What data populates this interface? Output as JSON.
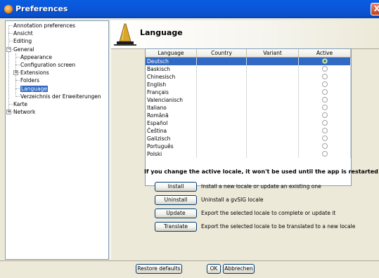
{
  "window": {
    "title": "Preferences",
    "close_glyph": "X"
  },
  "tree": {
    "items": [
      {
        "label": "Annotation preferences",
        "level": 0,
        "expander": ""
      },
      {
        "label": "Ansicht",
        "level": 0,
        "expander": ""
      },
      {
        "label": "Editing",
        "level": 0,
        "expander": ""
      },
      {
        "label": "General",
        "level": 0,
        "expander": "−"
      },
      {
        "label": "Appearance",
        "level": 1,
        "expander": ""
      },
      {
        "label": "Configuration screen",
        "level": 1,
        "expander": ""
      },
      {
        "label": "Extensions",
        "level": 1,
        "expander": "+"
      },
      {
        "label": "Folders",
        "level": 1,
        "expander": ""
      },
      {
        "label": "Language",
        "level": 1,
        "expander": "",
        "selected": true
      },
      {
        "label": "Verzeichnis der Erweiterungen",
        "level": 1,
        "expander": ""
      },
      {
        "label": "Karte",
        "level": 0,
        "expander": ""
      },
      {
        "label": "Network",
        "level": 0,
        "expander": "+"
      }
    ]
  },
  "panel": {
    "title": "Language",
    "icon": "lamp-icon"
  },
  "table": {
    "columns": [
      "Language",
      "Country",
      "Variant",
      "Active"
    ],
    "rows": [
      {
        "language": "Deutsch",
        "country": "",
        "variant": "",
        "active": true,
        "selected": true
      },
      {
        "language": "Baskisch",
        "country": "",
        "variant": "",
        "active": false
      },
      {
        "language": "Chinesisch",
        "country": "",
        "variant": "",
        "active": false
      },
      {
        "language": "English",
        "country": "",
        "variant": "",
        "active": false
      },
      {
        "language": "Français",
        "country": "",
        "variant": "",
        "active": false
      },
      {
        "language": "Valencianisch",
        "country": "",
        "variant": "",
        "active": false
      },
      {
        "language": "Italiano",
        "country": "",
        "variant": "",
        "active": false
      },
      {
        "language": "Română",
        "country": "",
        "variant": "",
        "active": false
      },
      {
        "language": "Español",
        "country": "",
        "variant": "",
        "active": false
      },
      {
        "language": "Čeština",
        "country": "",
        "variant": "",
        "active": false
      },
      {
        "language": "Galizisch",
        "country": "",
        "variant": "",
        "active": false
      },
      {
        "language": "Português",
        "country": "",
        "variant": "",
        "active": false
      },
      {
        "language": "Polski",
        "country": "",
        "variant": "",
        "active": false
      }
    ]
  },
  "notice": "If you change the active locale, it won't be used until the app is restarted",
  "actions": [
    {
      "label": "Install",
      "description": "Install a new locale or update an existing one"
    },
    {
      "label": "Uninstall",
      "description": "Uninstall a gvSIG locale"
    },
    {
      "label": "Update",
      "description": "Export the selected locale to complete or update it"
    },
    {
      "label": "Translate",
      "description": "Export the selected locale to be translated to a new locale"
    }
  ],
  "footer": {
    "restore_label": "Restore defaults",
    "ok_label": "OK",
    "cancel_label": "Abbrechen"
  },
  "colors": {
    "titlebar": "#0b57db",
    "selection": "#316ac5",
    "window_bg": "#ece9d8"
  }
}
